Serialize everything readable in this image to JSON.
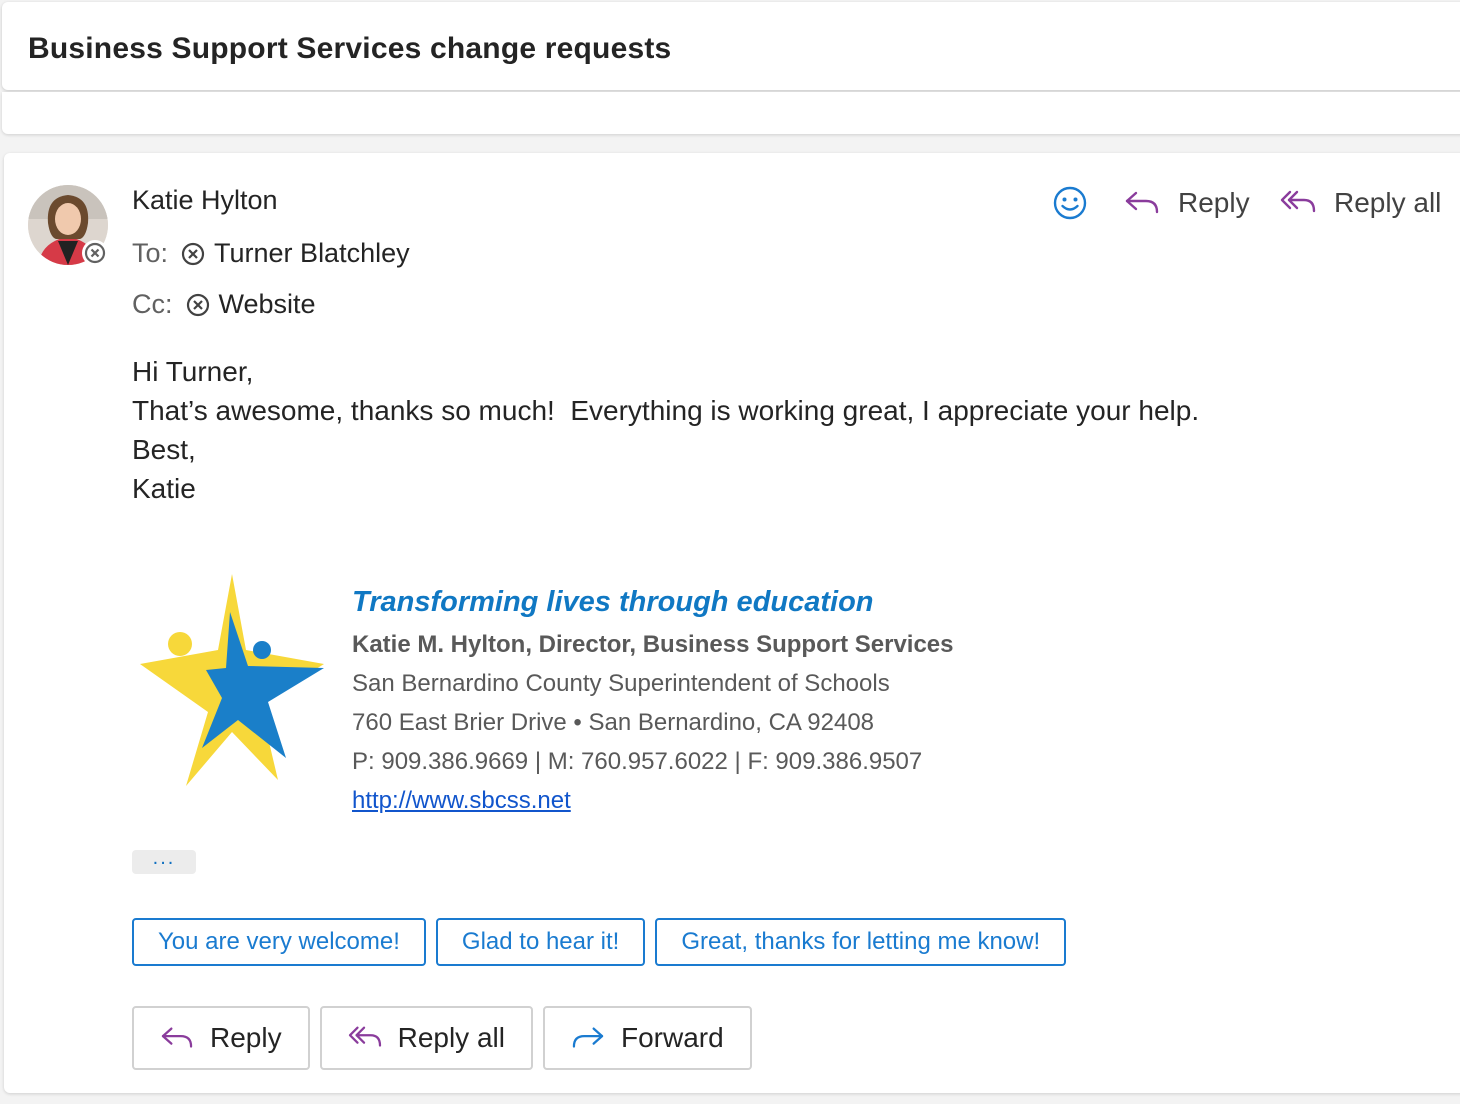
{
  "subject": "Business Support Services change requests",
  "sender": {
    "name": "Katie Hylton",
    "avatar_icon": "person-photo"
  },
  "recipients": {
    "to_label": "To:",
    "to": "Turner Blatchley",
    "cc_label": "Cc:",
    "cc": "Website"
  },
  "actions": {
    "reply": "Reply",
    "reply_all": "Reply all",
    "forward": "Forward",
    "emoji_icon": "smiley-icon"
  },
  "body": {
    "lines": [
      "Hi Turner,",
      "That’s awesome, thanks so much!  Everything is working great, I appreciate your help.",
      "Best,",
      "Katie"
    ]
  },
  "signature": {
    "tagline": "Transforming lives through education",
    "name_title": "Katie M. Hylton, Director, Business Support Services",
    "org": "San Bernardino County Superintendent of Schools",
    "address": "760 East Brier Drive • San Bernardino, CA 92408",
    "phones": "P: 909.386.9669 | M: 760.957.6022 | F: 909.386.9507",
    "url": "http://www.sbcss.net"
  },
  "ellipsis": "...",
  "suggested_replies": [
    "You are very welcome!",
    "Glad to hear it!",
    "Great, thanks for letting me know!"
  ],
  "colors": {
    "accent": "#1a7bd0",
    "reply_icon": "#8a3c9c",
    "forward_icon": "#1a7bd0",
    "logo_yellow": "#f7d83a",
    "logo_blue": "#1a7fc9"
  }
}
